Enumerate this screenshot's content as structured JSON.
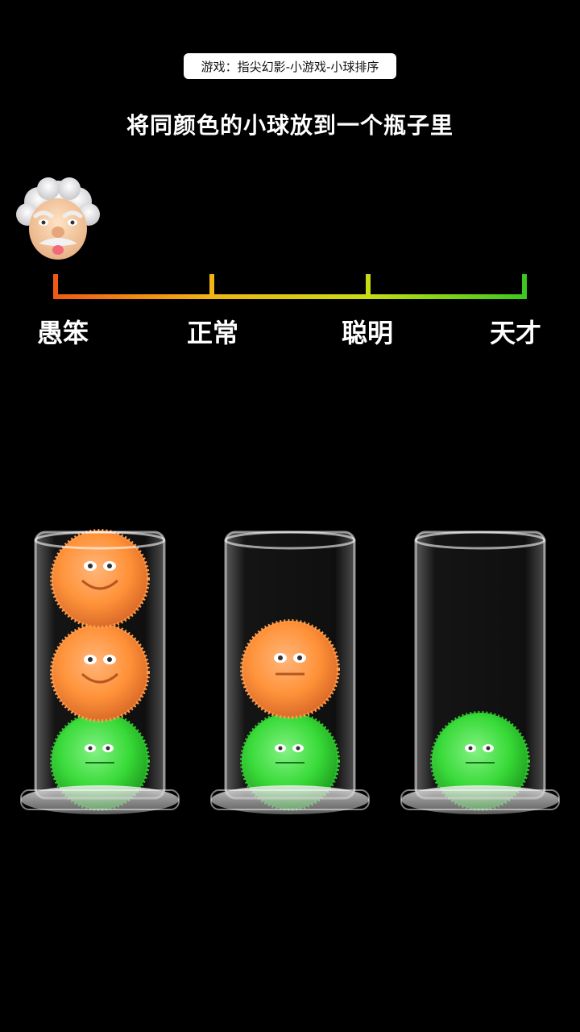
{
  "header": {
    "tag_text": "游戏：指尖幻影-小游戏-小球排序",
    "instruction": "将同颜色的小球放到一个瓶子里"
  },
  "scale": {
    "labels": [
      "愚笨",
      "正常",
      "聪明",
      "天才"
    ],
    "colors": [
      "#f05a14",
      "#f0b414",
      "#c8dc14",
      "#3cc81e"
    ]
  },
  "avatar": {
    "icon": "einstein-face-icon"
  },
  "colors": {
    "orange_ball": "#ff8a2a",
    "green_ball": "#2ad82a",
    "background": "#000000"
  },
  "bottles": [
    {
      "balls_bottom_to_top": [
        "green",
        "orange",
        "orange"
      ]
    },
    {
      "balls_bottom_to_top": [
        "green",
        "orange"
      ]
    },
    {
      "balls_bottom_to_top": [
        "green"
      ]
    }
  ]
}
